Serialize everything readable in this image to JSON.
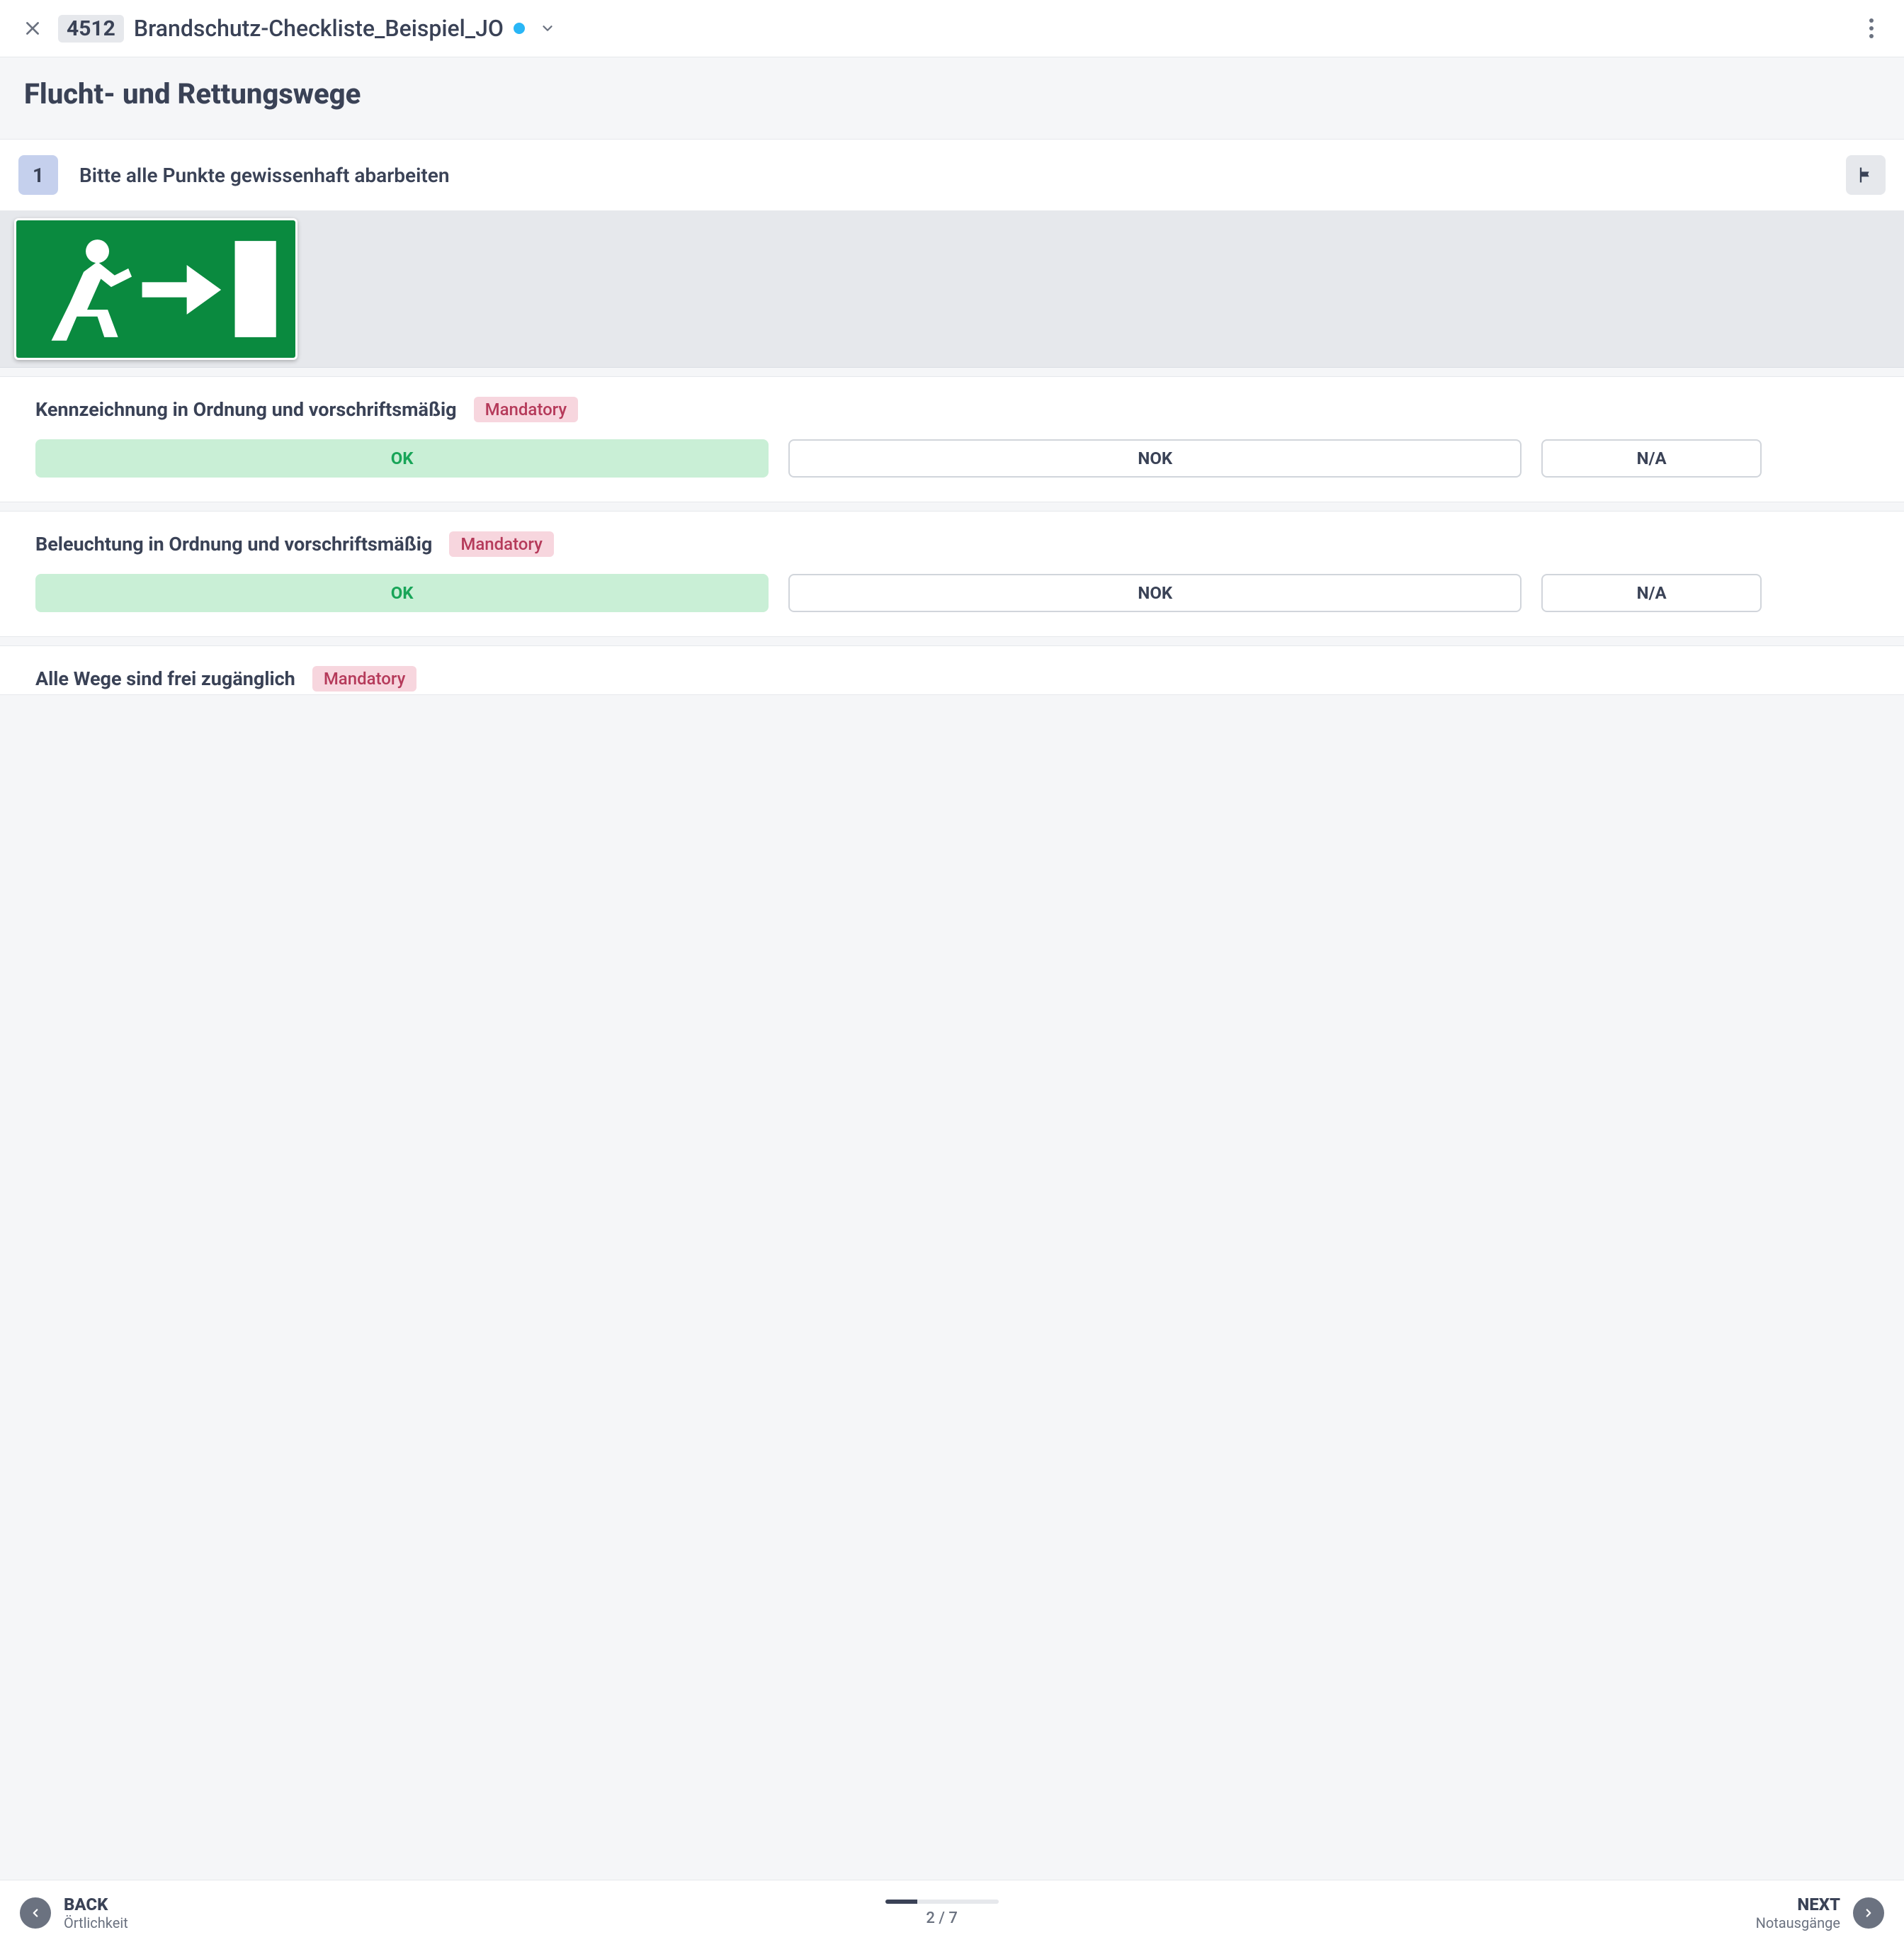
{
  "header": {
    "id": "4512",
    "title": "Brandschutz-Checkliste_Beispiel_JO",
    "status_color": "#29b6f6"
  },
  "section": {
    "title": "Flucht- und Rettungswege"
  },
  "instruction": {
    "number": "1",
    "text": "Bitte alle Punkte gewissenhaft abarbeiten"
  },
  "labels": {
    "mandatory": "Mandatory",
    "ok": "OK",
    "nok": "NOK",
    "na": "N/A"
  },
  "questions": [
    {
      "text": "Kennzeichnung in Ordnung und vorschriftsmäßig",
      "mandatory": true,
      "selected": "OK"
    },
    {
      "text": "Beleuchtung in Ordnung und vorschriftsmäßig",
      "mandatory": true,
      "selected": "OK"
    },
    {
      "text": "Alle Wege sind frei zugänglich",
      "mandatory": true,
      "selected": null
    }
  ],
  "footer": {
    "back_label": "BACK",
    "back_sub": "Örtlichkeit",
    "next_label": "NEXT",
    "next_sub": "Notausgänge",
    "page_current": 2,
    "page_total": 7,
    "page_text": "2 / 7",
    "progress_percent": 28.6
  }
}
